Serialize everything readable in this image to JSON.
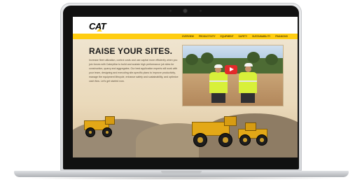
{
  "brand": {
    "logo_text": "CAT",
    "accent": "#ffcd11"
  },
  "nav": {
    "items": [
      "OVERVIEW",
      "PRODUCTIVITY",
      "EQUIPMENT",
      "SAFETY",
      "SUSTAINABILITY",
      "FINANCING"
    ]
  },
  "hero": {
    "headline": "RAISE YOUR SITES.",
    "body": "Increase fleet utilization, control costs and use capital more efficiently when you join forces with Caterpillar to build and sustain high performance job sites for construction, quarry and aggregates. Our best application experts will work with your team, designing and executing site-specific plans to improve productivity, manage the equipment lifecycle, enhance safety and sustainability, and optimize cash flow. Let's get started now."
  },
  "video": {
    "play_icon": "play-icon"
  }
}
